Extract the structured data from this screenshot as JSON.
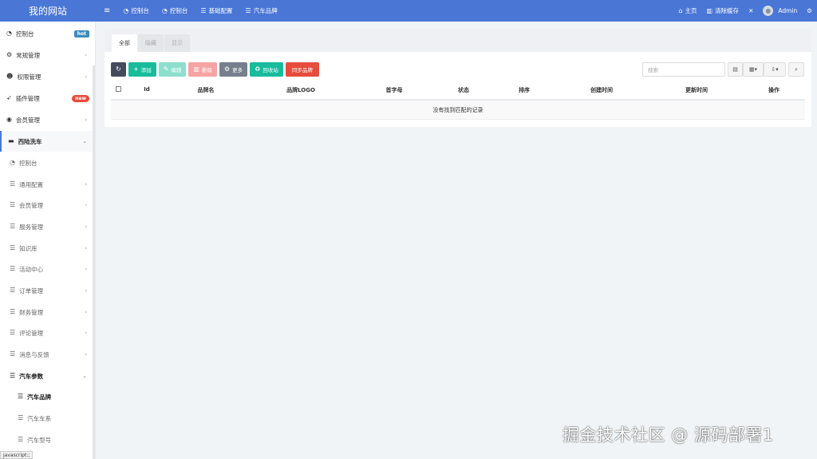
{
  "brand": "我的网站",
  "topnav": [
    {
      "icon": "dashboard-icon",
      "label": "控制台"
    },
    {
      "icon": "dashboard-icon",
      "label": "控制台"
    },
    {
      "icon": "list-icon",
      "label": "基础配置"
    },
    {
      "icon": "list-icon",
      "label": "汽车品牌"
    }
  ],
  "topright": {
    "home": "主页",
    "clear_cache": "清除缓存",
    "user": "Admin"
  },
  "sidebar": {
    "items": [
      {
        "label": "控制台",
        "badge": "hot"
      },
      {
        "label": "常规管理"
      },
      {
        "label": "权限管理"
      },
      {
        "label": "插件管理",
        "badge": "new"
      },
      {
        "label": "会员管理"
      },
      {
        "label": "西陆洗车"
      },
      {
        "label": "控制台"
      },
      {
        "label": "通用配置"
      },
      {
        "label": "会员管理"
      },
      {
        "label": "服务管理"
      },
      {
        "label": "知识库"
      },
      {
        "label": "活动中心"
      },
      {
        "label": "订单管理"
      },
      {
        "label": "财务管理"
      },
      {
        "label": "评论管理"
      },
      {
        "label": "消息与反馈"
      },
      {
        "label": "汽车参数"
      },
      {
        "label": "汽车品牌"
      },
      {
        "label": "汽车车系"
      },
      {
        "label": "汽车型号"
      }
    ]
  },
  "status_bar": "javascript:;",
  "tabs": [
    "全部",
    "隐藏",
    "显示"
  ],
  "toolbar": {
    "add": "添加",
    "edit": "编辑",
    "delete": "删除",
    "more": "更多",
    "recycle": "回收站",
    "sync": "同步品牌"
  },
  "search": {
    "placeholder": "搜索"
  },
  "table": {
    "headers": [
      "Id",
      "品牌名",
      "品牌LOGO",
      "首字母",
      "状态",
      "排序",
      "创建时间",
      "更新时间",
      "操作"
    ],
    "empty": "没有找到匹配的记录"
  },
  "watermark": "掘金技术社区 @ 源码部署1",
  "colors": {
    "topbar": "#4a76d6",
    "green": "#18bc9c",
    "red": "#e74c3c",
    "dark": "#444b5a"
  }
}
